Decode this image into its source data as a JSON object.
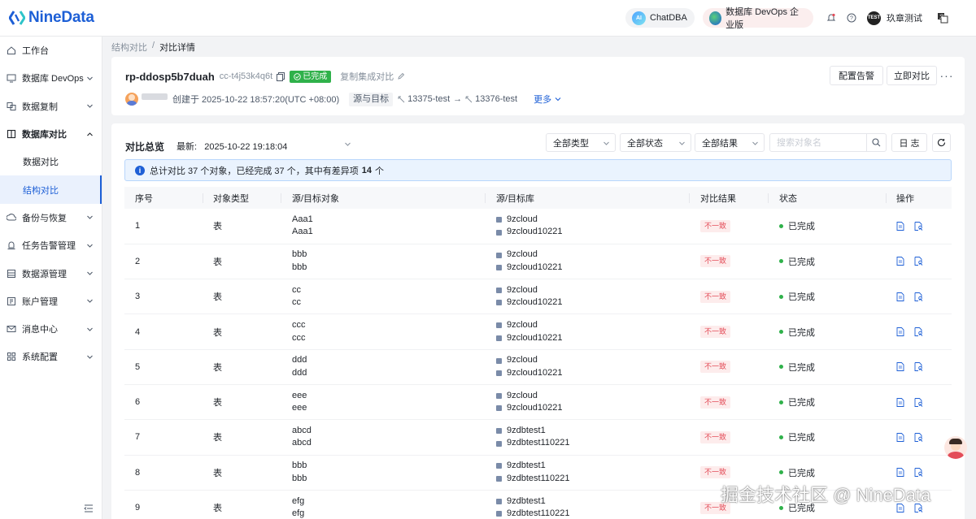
{
  "header": {
    "brand": "NineData",
    "chatdba": "ChatDBA",
    "edition": "数据库 DevOps 企业版",
    "user_badge": "TEST",
    "user_name": "玖章测试"
  },
  "sidebar": {
    "items": [
      {
        "label": "工作台",
        "icon": "home-icon"
      },
      {
        "label": "数据库 DevOps",
        "icon": "monitor-icon"
      },
      {
        "label": "数据复制",
        "icon": "replicate-icon"
      },
      {
        "label": "数据库对比",
        "icon": "compare-icon"
      },
      {
        "label": "备份与恢复",
        "icon": "backup-icon"
      },
      {
        "label": "任务告警管理",
        "icon": "alarm-icon"
      },
      {
        "label": "数据源管理",
        "icon": "datasource-icon"
      },
      {
        "label": "账户管理",
        "icon": "account-icon"
      },
      {
        "label": "消息中心",
        "icon": "mail-icon"
      },
      {
        "label": "系统配置",
        "icon": "grid-icon"
      }
    ],
    "sub_items": [
      {
        "label": "数据对比"
      },
      {
        "label": "结构对比"
      }
    ]
  },
  "breadcrumb": {
    "parent": "结构对比",
    "sep": "/",
    "current": "对比详情"
  },
  "task": {
    "name": "rp-ddosp5b7duah",
    "id": "cc-t4j53k4q6t",
    "status": "已完成",
    "copy_label": "复制集成对比",
    "created": "创建于 2025-10-22 18:57:20(UTC +08:00)",
    "src_tgt_label": "源与目标",
    "source": "13375-test",
    "arrow": "→",
    "target": "13376-test",
    "more": "更多",
    "alarm_btn": "配置告警",
    "run_btn": "立即对比"
  },
  "overview": {
    "title": "对比总览",
    "latest": "最新:   2025-10-22 19:18:04",
    "filters": {
      "type": "全部类型",
      "status": "全部状态",
      "result": "全部结果"
    },
    "search_placeholder": "搜索对象名",
    "log_btn": "日 志",
    "summary_prefix": "总计对比 37 个对象，已经完成 37 个，其中有差异项",
    "summary_count": "14",
    "summary_suffix": "个"
  },
  "table": {
    "headers": [
      "序号",
      "对象类型",
      "源/目标对象",
      "源/目标库",
      "对比结果",
      "状态",
      "操作"
    ],
    "rows": [
      {
        "idx": "1",
        "type": "表",
        "src_obj": "Aaa1",
        "tgt_obj": "Aaa1",
        "src_db": "9zcloud",
        "tgt_db": "9zcloud10221",
        "result": "不一致",
        "status": "已完成"
      },
      {
        "idx": "2",
        "type": "表",
        "src_obj": "bbb",
        "tgt_obj": "bbb",
        "src_db": "9zcloud",
        "tgt_db": "9zcloud10221",
        "result": "不一致",
        "status": "已完成"
      },
      {
        "idx": "3",
        "type": "表",
        "src_obj": "cc",
        "tgt_obj": "cc",
        "src_db": "9zcloud",
        "tgt_db": "9zcloud10221",
        "result": "不一致",
        "status": "已完成"
      },
      {
        "idx": "4",
        "type": "表",
        "src_obj": "ccc",
        "tgt_obj": "ccc",
        "src_db": "9zcloud",
        "tgt_db": "9zcloud10221",
        "result": "不一致",
        "status": "已完成"
      },
      {
        "idx": "5",
        "type": "表",
        "src_obj": "ddd",
        "tgt_obj": "ddd",
        "src_db": "9zcloud",
        "tgt_db": "9zcloud10221",
        "result": "不一致",
        "status": "已完成"
      },
      {
        "idx": "6",
        "type": "表",
        "src_obj": "eee",
        "tgt_obj": "eee",
        "src_db": "9zcloud",
        "tgt_db": "9zcloud10221",
        "result": "不一致",
        "status": "已完成"
      },
      {
        "idx": "7",
        "type": "表",
        "src_obj": "abcd",
        "tgt_obj": "abcd",
        "src_db": "9zdbtest1",
        "tgt_db": "9zdbtest110221",
        "result": "不一致",
        "status": "已完成"
      },
      {
        "idx": "8",
        "type": "表",
        "src_obj": "bbb",
        "tgt_obj": "bbb",
        "src_db": "9zdbtest1",
        "tgt_db": "9zdbtest110221",
        "result": "不一致",
        "status": "已完成"
      },
      {
        "idx": "9",
        "type": "表",
        "src_obj": "efg",
        "tgt_obj": "efg",
        "src_db": "9zdbtest1",
        "tgt_db": "9zdbtest110221",
        "result": "不一致",
        "status": "已完成"
      }
    ]
  },
  "watermark": "掘金技术社区 @ NineData",
  "colors": {
    "brand": "#1d5fd6",
    "success": "#2fb14a",
    "danger": "#e34d59",
    "info_bg": "#eaf3fe"
  }
}
